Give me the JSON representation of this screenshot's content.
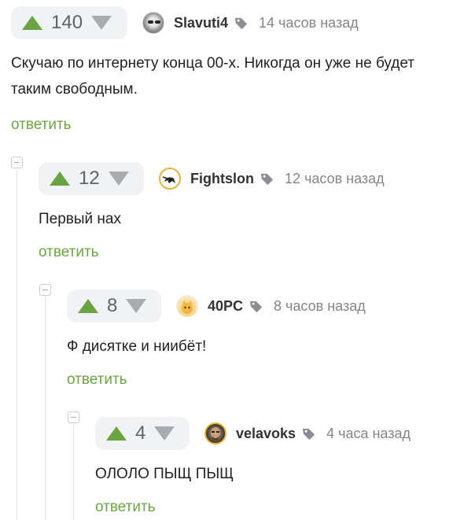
{
  "comments": [
    {
      "score": "140",
      "author": "Slavuti4",
      "time": "14 часов назад",
      "text": "Скучаю по интернету конца 00-х. Никогда он уже не будет\nтаким свободным.",
      "reply": "ответить",
      "avatar_icon": "avatar-grayscale-face",
      "tag_icon": "tag-icon"
    },
    {
      "score": "12",
      "author": "Fightslon",
      "time": "12 часов назад",
      "text": "Первый нах",
      "reply": "ответить",
      "avatar_icon": "avatar-elephant-figure",
      "tag_icon": "tag-icon"
    },
    {
      "score": "8",
      "author": "40PC",
      "time": "8 часов назад",
      "text": "Ф дисятке и ниибёт!",
      "reply": "ответить",
      "avatar_icon": "avatar-cartoon-cat",
      "tag_icon": "tag-icon"
    },
    {
      "score": "4",
      "author": "velavoks",
      "time": "4 часа назад",
      "text": "ОЛОЛО ПЫЩ ПЫЩ",
      "reply": "ответить",
      "avatar_icon": "avatar-bald-man",
      "tag_icon": "tag-icon"
    }
  ],
  "colors": {
    "upvote": "#69a342",
    "downvote": "#a8abb0",
    "reply_link": "#6aa642",
    "rating_bg": "#f1f2f4",
    "time_text": "#82868c"
  }
}
